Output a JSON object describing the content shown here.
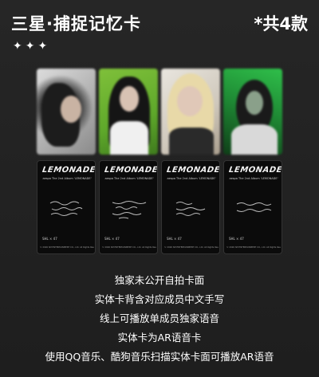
{
  "header": {
    "title": "三星·捕捉记忆卡",
    "count": "*共4款",
    "stars": "✦✦✦"
  },
  "card_backs": {
    "logo": "LEMONADE",
    "subtitle": "aespa The 2nd Album 'LEMONADE'",
    "signature_label": "SHL × 47",
    "copyright": "© 2026 SM ENTERTAINMENT CO., Ltd. All Rights Reserved"
  },
  "features": [
    "独家未公开自拍卡面",
    "实体卡背含对应成员中文手写",
    "线上可播放单成员独家语音",
    "实体卡为AR语音卡",
    "使用QQ音乐、酷狗音乐扫描实体卡面可播放AR语音"
  ],
  "colors": {
    "background": "#222222",
    "text": "#ffffff",
    "card_back": "#0b0b0b"
  }
}
